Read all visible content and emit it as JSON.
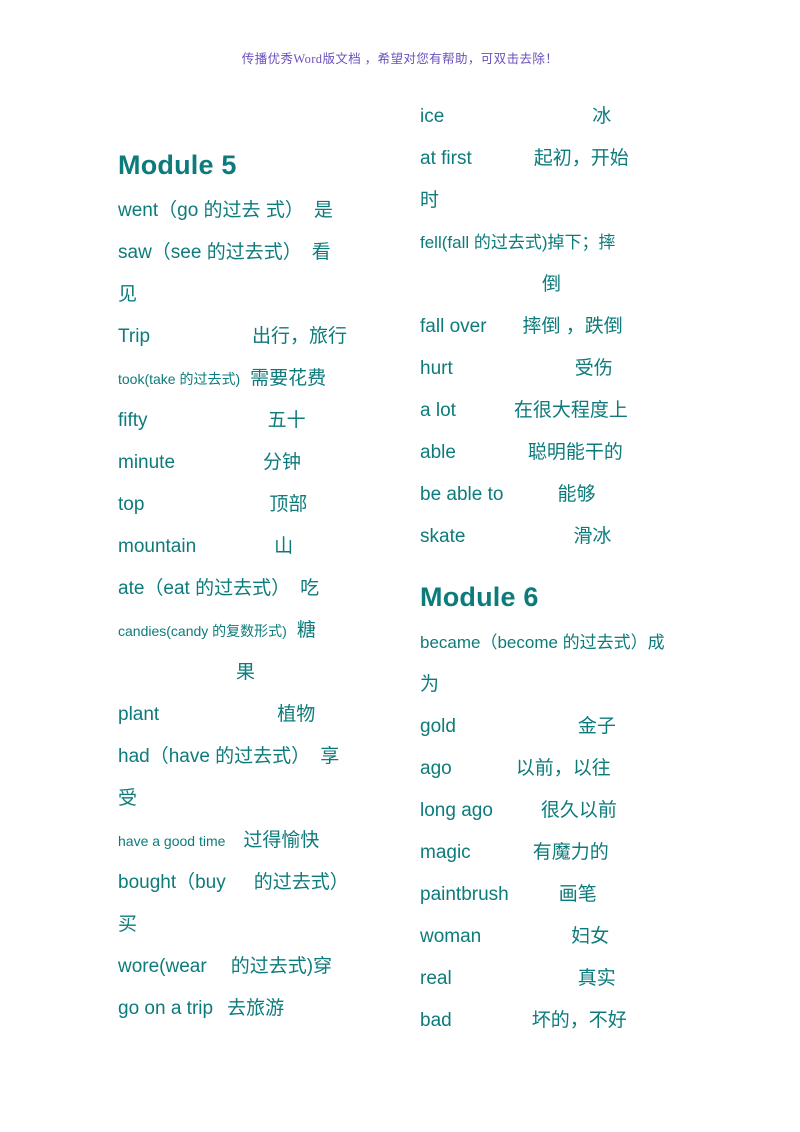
{
  "promo": {
    "text": "传播优秀Word版文档 ，希望对您有帮助，可双击去除！",
    "color": "#6b4fbb"
  },
  "theme": {
    "accent": "#0d7b7b",
    "background": "#ffffff"
  },
  "left_column": {
    "heading": "Module 5",
    "entries": [
      {
        "term": "went（go 的过去 式）",
        "gap": "  ",
        "defn": "是",
        "wrap": "",
        "size": "lg"
      },
      {
        "term": "saw（see 的过去式）",
        "gap": "   ",
        "defn": "看",
        "wrap": "见",
        "size": "lg"
      },
      {
        "term": "Trip",
        "gap": "",
        "defn": "出行，旅行",
        "wrap": "",
        "size": "lg",
        "pad": 102
      },
      {
        "term": "took(take 的过去式)",
        "gap": "",
        "defn": "需要花费",
        "wrap": "",
        "size": "sm"
      },
      {
        "term": "fifty",
        "gap": "",
        "defn": "五十",
        "wrap": "",
        "size": "lg",
        "pad": 120
      },
      {
        "term": "minute",
        "gap": "",
        "defn": "分钟",
        "wrap": "",
        "size": "lg",
        "pad": 88
      },
      {
        "term": "top",
        "gap": "",
        "defn": "顶部",
        "wrap": "",
        "size": "lg",
        "pad": 125
      },
      {
        "term": "mountain",
        "gap": "",
        "defn": "山",
        "wrap": "",
        "size": "lg",
        "pad": 78
      },
      {
        "term": "ate（eat 的过去式）",
        "gap": " ",
        "defn": "吃",
        "wrap": "",
        "size": "lg"
      },
      {
        "term": "candies(candy 的复数形式)",
        "gap": "",
        "defn": "糖",
        "wrap": "果",
        "size": "sm"
      },
      {
        "term": "plant",
        "gap": "",
        "defn": "植物",
        "wrap": "",
        "size": "lg",
        "pad": 118
      },
      {
        "term": "had（have 的过去式）",
        "gap": " ",
        "defn": "享",
        "wrap": "受",
        "size": "lg"
      },
      {
        "term": "have a good time",
        "gap": "",
        "defn": "过得愉快",
        "wrap": "",
        "size": "sm",
        "pad": 18
      },
      {
        "term": "bought（buy",
        "gap": "",
        "defn": "的过去式）",
        "wrap": "买",
        "size": "lg",
        "pad": 28
      },
      {
        "term": "wore(wear",
        "gap": "",
        "defn": "的过去式)穿",
        "wrap": "",
        "size": "lg",
        "pad": 24
      },
      {
        "term": "go on a trip",
        "gap": "",
        "defn": "去旅游",
        "wrap": "",
        "size": "lg",
        "pad": 14
      }
    ]
  },
  "right_column": {
    "heading_top_entries": [
      {
        "term": "ice",
        "gap": "",
        "defn": "冰",
        "wrap": "",
        "size": "lg",
        "pad": 148
      },
      {
        "term": "at first",
        "gap": "",
        "defn": "起初，开始",
        "wrap": "时",
        "size": "lg",
        "pad": 62
      },
      {
        "term": "fell(fall 的过去式)掉下；摔",
        "gap": "",
        "defn": "",
        "wrap": "倒",
        "size": "md",
        "wrap_indent": "mid"
      },
      {
        "term": "fall over",
        "gap": "",
        "defn": "摔倒 ，跌倒",
        "wrap": "",
        "size": "lg",
        "pad": 36
      },
      {
        "term": "hurt",
        "gap": "",
        "defn": "受伤",
        "wrap": "",
        "size": "lg",
        "pad": 122
      },
      {
        "term": "a lot",
        "gap": "",
        "defn": "在很大程度上",
        "wrap": "",
        "size": "lg",
        "pad": 58
      },
      {
        "term": "able",
        "gap": "",
        "defn": "聪明能干的",
        "wrap": "",
        "size": "lg",
        "pad": 72
      },
      {
        "term": "be able to",
        "gap": "",
        "defn": "能够",
        "wrap": "",
        "size": "lg",
        "pad": 54
      },
      {
        "term": "skate",
        "gap": "",
        "defn": "滑冰",
        "wrap": "",
        "size": "lg",
        "pad": 108
      }
    ],
    "heading": "Module 6",
    "entries": [
      {
        "term": "became（become 的过去式）成",
        "gap": "",
        "defn": "",
        "wrap": "为",
        "size": "md",
        "wrap_indent": "zero"
      },
      {
        "term": "gold",
        "gap": "",
        "defn": "金子",
        "wrap": "",
        "size": "lg",
        "pad": 122
      },
      {
        "term": "ago",
        "gap": "",
        "defn": "以前，以往",
        "wrap": "",
        "size": "lg",
        "pad": 64
      },
      {
        "term": "long ago",
        "gap": "",
        "defn": "很久以前",
        "wrap": "",
        "size": "lg",
        "pad": 48
      },
      {
        "term": "magic",
        "gap": "",
        "defn": "有魔力的",
        "wrap": "",
        "size": "lg",
        "pad": 62
      },
      {
        "term": "paintbrush",
        "gap": "",
        "defn": "画笔",
        "wrap": "",
        "size": "lg",
        "pad": 50
      },
      {
        "term": "woman",
        "gap": "",
        "defn": "妇女",
        "wrap": "",
        "size": "lg",
        "pad": 90
      },
      {
        "term": "real",
        "gap": "",
        "defn": "真实",
        "wrap": "",
        "size": "lg",
        "pad": 126
      },
      {
        "term": "bad",
        "gap": "",
        "defn": "坏的，不好",
        "wrap": "",
        "size": "lg",
        "pad": 80
      }
    ]
  }
}
